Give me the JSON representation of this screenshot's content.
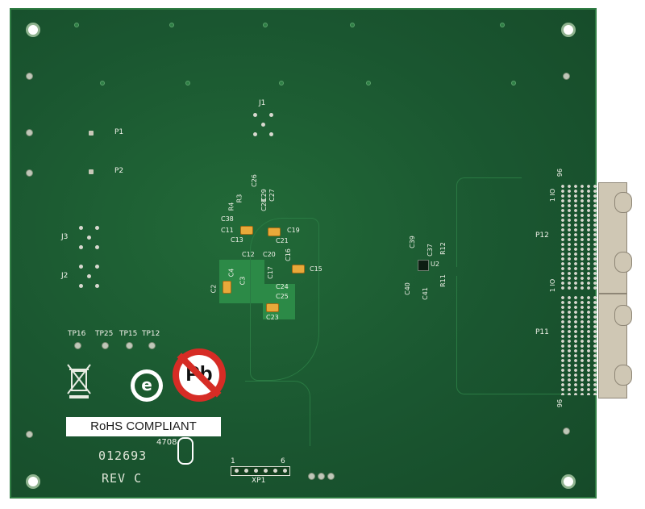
{
  "silkscreen": {
    "j1": "J1",
    "p1": "P1",
    "p2": "P2",
    "j3": "J3",
    "j2": "J2",
    "tp16": "TP16",
    "tp25": "TP25",
    "tp15": "TP15",
    "tp12": "TP12",
    "c38": "C38",
    "c11": "C11",
    "c13": "C13",
    "c19": "C19",
    "c21": "C21",
    "c12": "C12",
    "c20": "C20",
    "c16": "C16",
    "c15": "C15",
    "c4": "C4",
    "c3": "C3",
    "c2": "C2",
    "c17": "C17",
    "c24": "C24",
    "c25": "C25",
    "c23": "C23",
    "c26": "C26",
    "c27": "C27",
    "c28": "C28",
    "c29": "C29",
    "r3": "R3",
    "r4": "R4",
    "c39": "C39",
    "c37": "C37",
    "r12": "R12",
    "u2": "U2",
    "c40": "C40",
    "c41": "C41",
    "r11": "R11",
    "p12": "P12",
    "p11": "P11",
    "xp1": "XP1",
    "xp1_pin1": "1",
    "xp1_pin6": "6",
    "rohs_label": "RoHS COMPLIANT",
    "code_4708": "4708",
    "part_number": "012693",
    "revision": "REV C",
    "pb_text": "Pb",
    "e_mark": "e",
    "conn_top_label": "96",
    "conn_io": "1 IO",
    "conn_mid": "1 IO",
    "conn_bottom_label": "96"
  },
  "colors": {
    "board": "#1b5a2e",
    "silkscreen": "#f2f2ea",
    "copper_pour": "#2c8a47",
    "capacitor": "#e9a93a",
    "connector": "#cfc7b4"
  }
}
